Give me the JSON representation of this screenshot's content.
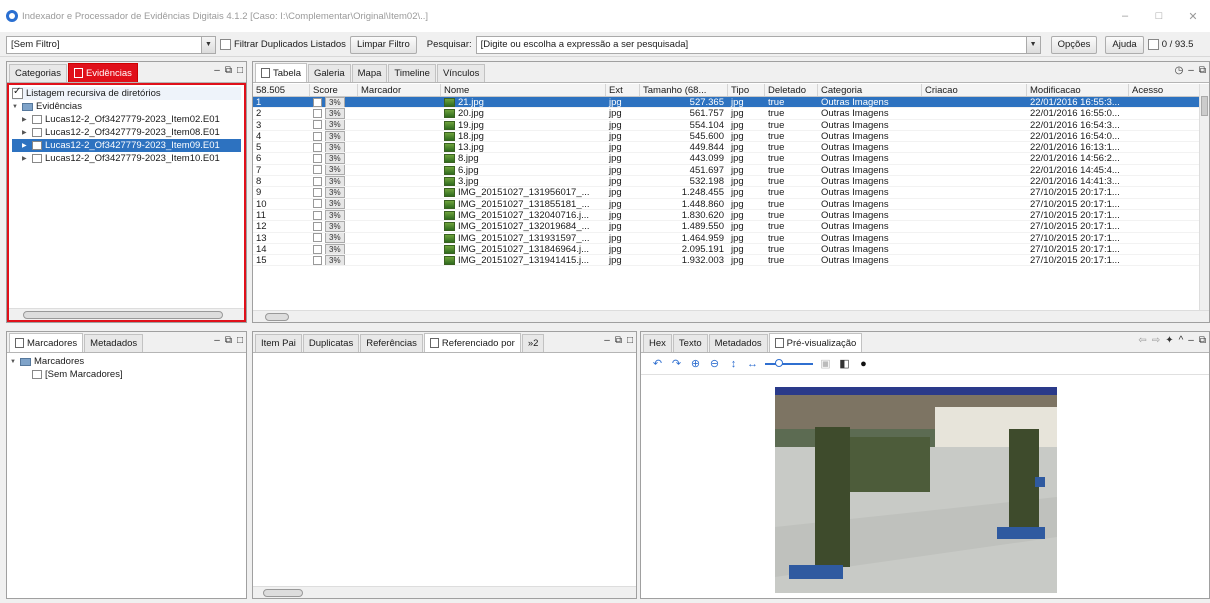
{
  "window": {
    "title": "Indexador e Processador de Evidências Digitais 4.1.2   [Caso: I:\\Complementar\\Original\\Item02\\..]",
    "minimize": "–",
    "maximize": "□",
    "close": "✕"
  },
  "toolbar": {
    "filter_select": "[Sem Filtro]",
    "filter_duplicates_label": "Filtrar Duplicados Listados",
    "clear_filter": "Limpar Filtro",
    "search_label": "Pesquisar:",
    "search_placeholder": "[Digite ou escolha a expressão a ser pesquisada]",
    "options": "Opções",
    "help": "Ajuda",
    "count": "0 / 93.5"
  },
  "left_panel": {
    "tabs": [
      "Categorias",
      "Evidências"
    ],
    "recursive_label": "Listagem recursiva de diretórios",
    "root": "Evidências",
    "items": [
      "Lucas12-2_Of3427779-2023_Item02.E01",
      "Lucas12-2_Of3427779-2023_Item08.E01",
      "Lucas12-2_Of3427779-2023_Item09.E01",
      "Lucas12-2_Of3427779-2023_Item10.E01"
    ],
    "selected_index": 2
  },
  "results": {
    "tabs": [
      "Tabela",
      "Galeria",
      "Mapa",
      "Timeline",
      "Vínculos"
    ],
    "columns": [
      "58.505",
      "Score",
      "Marcador",
      "Nome",
      "Ext",
      "Tamanho (68...",
      "Tipo",
      "Deletado",
      "Categoria",
      "Criacao",
      "Modificacao",
      "Acesso"
    ],
    "rows": [
      [
        "1",
        "3%",
        "",
        "21.jpg",
        "jpg",
        "527.365",
        "jpg",
        "true",
        "Outras Imagens",
        "",
        "22/01/2016 16:55:3..."
      ],
      [
        "2",
        "3%",
        "",
        "20.jpg",
        "jpg",
        "561.757",
        "jpg",
        "true",
        "Outras Imagens",
        "",
        "22/01/2016 16:55:0..."
      ],
      [
        "3",
        "3%",
        "",
        "19.jpg",
        "jpg",
        "554.104",
        "jpg",
        "true",
        "Outras Imagens",
        "",
        "22/01/2016 16:54:3..."
      ],
      [
        "4",
        "3%",
        "",
        "18.jpg",
        "jpg",
        "545.600",
        "jpg",
        "true",
        "Outras Imagens",
        "",
        "22/01/2016 16:54:0..."
      ],
      [
        "5",
        "3%",
        "",
        "13.jpg",
        "jpg",
        "449.844",
        "jpg",
        "true",
        "Outras Imagens",
        "",
        "22/01/2016 16:13:1..."
      ],
      [
        "6",
        "3%",
        "",
        "8.jpg",
        "jpg",
        "443.099",
        "jpg",
        "true",
        "Outras Imagens",
        "",
        "22/01/2016 14:56:2..."
      ],
      [
        "7",
        "3%",
        "",
        "6.jpg",
        "jpg",
        "451.697",
        "jpg",
        "true",
        "Outras Imagens",
        "",
        "22/01/2016 14:45:4..."
      ],
      [
        "8",
        "3%",
        "",
        "3.jpg",
        "jpg",
        "532.198",
        "jpg",
        "true",
        "Outras Imagens",
        "",
        "22/01/2016 14:41:3..."
      ],
      [
        "9",
        "3%",
        "",
        "IMG_20151027_131956017_...",
        "jpg",
        "1.248.455",
        "jpg",
        "true",
        "Outras Imagens",
        "",
        "27/10/2015 20:17:1..."
      ],
      [
        "10",
        "3%",
        "",
        "IMG_20151027_131855181_...",
        "jpg",
        "1.448.860",
        "jpg",
        "true",
        "Outras Imagens",
        "",
        "27/10/2015 20:17:1..."
      ],
      [
        "11",
        "3%",
        "",
        "IMG_20151027_132040716.j...",
        "jpg",
        "1.830.620",
        "jpg",
        "true",
        "Outras Imagens",
        "",
        "27/10/2015 20:17:1..."
      ],
      [
        "12",
        "3%",
        "",
        "IMG_20151027_132019684_...",
        "jpg",
        "1.489.550",
        "jpg",
        "true",
        "Outras Imagens",
        "",
        "27/10/2015 20:17:1..."
      ],
      [
        "13",
        "3%",
        "",
        "IMG_20151027_131931597_...",
        "jpg",
        "1.464.959",
        "jpg",
        "true",
        "Outras Imagens",
        "",
        "27/10/2015 20:17:1..."
      ],
      [
        "14",
        "3%",
        "",
        "IMG_20151027_131846964.j...",
        "jpg",
        "2.095.191",
        "jpg",
        "true",
        "Outras Imagens",
        "",
        "27/10/2015 20:17:1..."
      ],
      [
        "15",
        "3%",
        "",
        "IMG_20151027_131941415.j...",
        "jpg",
        "1.932.003",
        "jpg",
        "true",
        "Outras Imagens",
        "",
        "27/10/2015 20:17:1..."
      ]
    ],
    "selected_index": 0
  },
  "bookmarks": {
    "tabs": [
      "Marcadores",
      "Metadados"
    ],
    "root": "Marcadores",
    "item": "[Sem Marcadores]"
  },
  "related": {
    "tabs": [
      "Item Pai",
      "Duplicatas",
      "Referências",
      "Referenciado por"
    ],
    "more": "»2"
  },
  "viewer": {
    "tabs": [
      "Hex",
      "Texto",
      "Metadados",
      "Pré-visualização"
    ]
  },
  "colors": {
    "accent": "#2d72c0",
    "red_tab": "#e0101a"
  }
}
